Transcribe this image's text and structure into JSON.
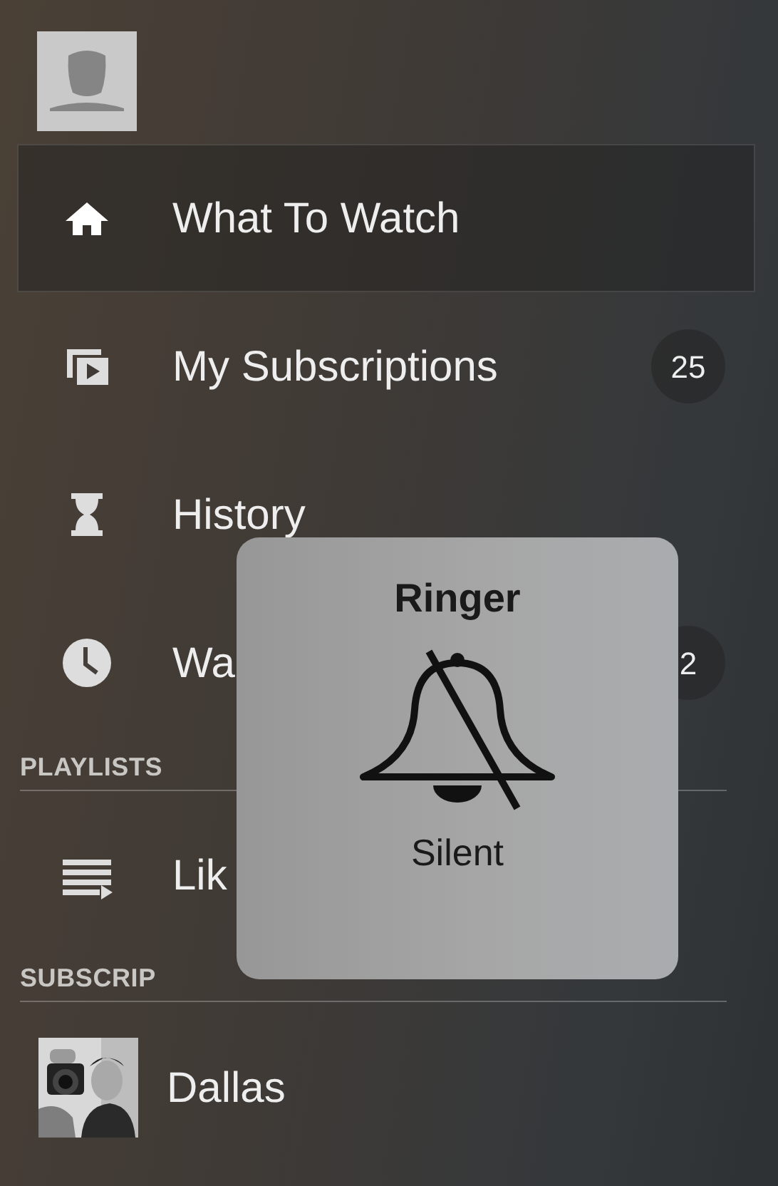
{
  "menu": [
    {
      "kind": "home",
      "label": "What To Watch",
      "selected": true
    },
    {
      "kind": "subscriptions",
      "label": "My Subscriptions",
      "badge": "25",
      "selected": false
    },
    {
      "kind": "history",
      "label": "History",
      "selected": false
    },
    {
      "kind": "clock",
      "label": "Wa",
      "badge": "2",
      "selected": false
    }
  ],
  "playlists": {
    "header": "PLAYLISTS",
    "items": [
      {
        "kind": "playlist",
        "label": "Lik"
      }
    ]
  },
  "subscriptions": {
    "header": "SUBSCRIP",
    "items": [
      {
        "label": "Dallas"
      }
    ]
  },
  "hud": {
    "title": "Ringer",
    "status": "Silent",
    "muted": true
  }
}
